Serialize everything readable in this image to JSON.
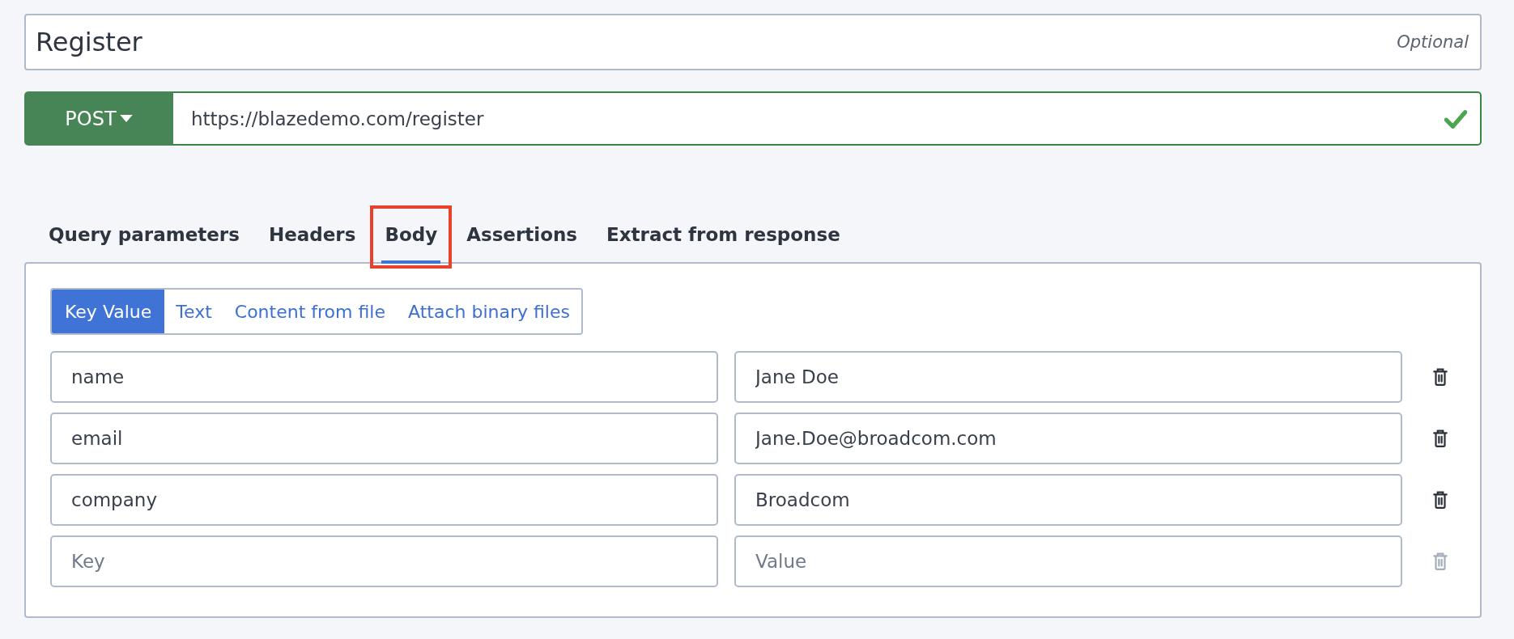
{
  "request_name": {
    "value": "Register",
    "hint": "Optional"
  },
  "method": {
    "label": "POST",
    "url": "https://blazedemo.com/register",
    "valid": true
  },
  "tabs": [
    {
      "label": "Query parameters",
      "selected": false,
      "highlighted": false
    },
    {
      "label": "Headers",
      "selected": false,
      "highlighted": false
    },
    {
      "label": "Body",
      "selected": true,
      "highlighted": true
    },
    {
      "label": "Assertions",
      "selected": false,
      "highlighted": false
    },
    {
      "label": "Extract from response",
      "selected": false,
      "highlighted": false
    }
  ],
  "body_modes": [
    {
      "label": "Key Value",
      "selected": true
    },
    {
      "label": "Text",
      "selected": false
    },
    {
      "label": "Content from file",
      "selected": false
    },
    {
      "label": "Attach binary files",
      "selected": false
    }
  ],
  "rows": [
    {
      "key": "name",
      "value": "Jane Doe",
      "disabled": false
    },
    {
      "key": "email",
      "value": "Jane.Doe@broadcom.com",
      "disabled": false
    },
    {
      "key": "company",
      "value": "Broadcom",
      "disabled": false
    },
    {
      "key_placeholder": "Key",
      "value_placeholder": "Value",
      "disabled": true
    }
  ]
}
